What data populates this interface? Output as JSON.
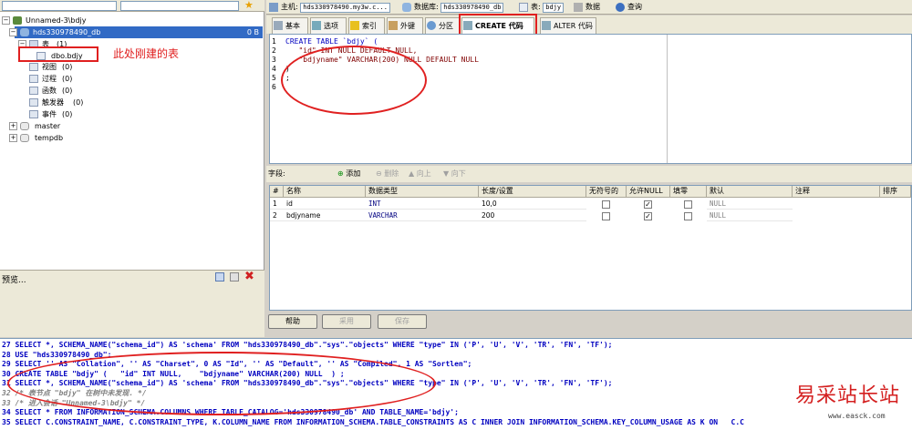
{
  "left": {
    "top_search": "",
    "connection": "Unnamed-3\\bdjy",
    "database": "hds330978490_db",
    "database_size": "0 B",
    "tables_label": "表",
    "tables_count": "(1)",
    "new_table": "dbo.bdjy",
    "nodes": [
      {
        "label": "视图",
        "count": "(0)"
      },
      {
        "label": "过程",
        "count": "(0)"
      },
      {
        "label": "函数",
        "count": "(0)"
      },
      {
        "label": "触发器",
        "count": "(0)"
      },
      {
        "label": "事件",
        "count": "(0)"
      }
    ],
    "other_dbs": [
      "master",
      "tempdb"
    ],
    "preview_label": "预览...",
    "annotation": "此处刚建的表"
  },
  "header": {
    "host_label": "主机:",
    "host_value": "hds330978490.my3w.c...",
    "db_label": "数据库:",
    "db_value": "hds330978490_db",
    "table_label": "表:",
    "table_value": "bdjy",
    "data_tab": "数据",
    "query_tab": "查询"
  },
  "subtabs": [
    "基本",
    "选项",
    "索引",
    "外键",
    "分区",
    "CREATE 代码",
    "ALTER 代码"
  ],
  "editor": {
    "lines": [
      "CREATE TABLE `bdjy` (",
      "   \"id\" INT NULL DEFAULT NULL,",
      "   \"bdjyname\" VARCHAR(200) NULL DEFAULT NULL",
      ")",
      ";",
      ""
    ]
  },
  "fields_bar": {
    "label": "字段:",
    "add": "添加",
    "delete": "删除",
    "up": "向上",
    "down": "向下"
  },
  "grid": {
    "headers": [
      "#",
      "名称",
      "数据类型",
      "长度/设置",
      "无符号的",
      "允许NULL",
      "填零",
      "默认",
      "注释",
      "排序"
    ],
    "rows": [
      {
        "num": "1",
        "name": "id",
        "type": "INT",
        "length": "10,0",
        "unsigned": false,
        "allow_null": true,
        "zerofill": false,
        "default": "NULL"
      },
      {
        "num": "2",
        "name": "bdjyname",
        "type": "VARCHAR",
        "length": "200",
        "unsigned": false,
        "allow_null": true,
        "zerofill": false,
        "default": "NULL"
      }
    ]
  },
  "buttons": {
    "help": "帮助",
    "discard": "采用",
    "save": "保存"
  },
  "log": [
    "27 SELECT *, SCHEMA_NAME(\"schema_id\") AS 'schema' FROM \"hds330978490_db\".\"sys\".\"objects\" WHERE \"type\" IN ('P', 'U', 'V', 'TR', 'FN', 'TF');",
    "28 USE \"hds330978490_db\";",
    "29 SELECT '' AS \"Collation\", '' AS \"Charset\", 0 AS \"Id\", '' AS \"Default\", '' AS \"Compiled\", 1 AS \"Sortlen\";",
    "30 CREATE TABLE \"bdjy\" (   \"id\" INT NULL,    \"bdjyname\" VARCHAR(200) NULL  ) ;",
    "31 SELECT *, SCHEMA_NAME(\"schema_id\") AS 'schema' FROM \"hds330978490_db\".\"sys\".\"objects\" WHERE \"type\" IN ('P', 'U', 'V', 'TR', 'FN', 'TF');",
    "32 /* 表节点 \"bdjy\" 在树中未发现. */",
    "33 /* 进入会话 \"Unnamed-3\\bdjy\" */",
    "34 SELECT * FROM INFORMATION_SCHEMA.COLUMNS WHERE TABLE_CATALOG='hds330978490_db' AND TABLE_NAME='bdjy';",
    "35 SELECT C.CONSTRAINT_NAME, C.CONSTRAINT_TYPE, K.COLUMN_NAME FROM INFORMATION_SCHEMA.TABLE_CONSTRAINTS AS C INNER JOIN INFORMATION_SCHEMA.KEY_COLUMN_USAGE AS K ON   C.C"
  ],
  "watermark": {
    "title": "易采站长站",
    "url": "www.easck.com"
  },
  "colors": {
    "annotation": "#e02020",
    "selection": "#316ac5",
    "keyword": "#0000c0"
  }
}
